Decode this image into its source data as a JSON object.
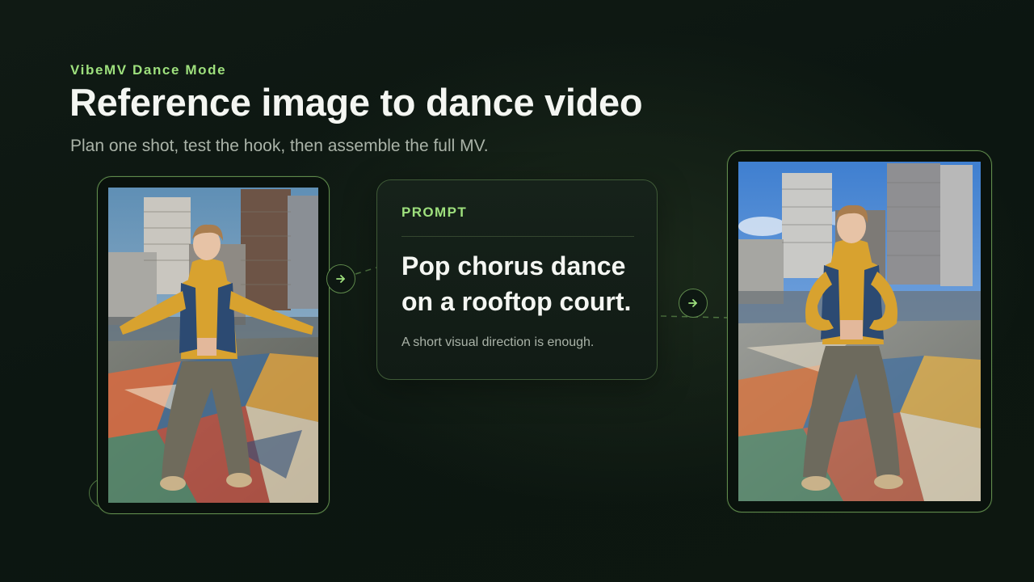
{
  "header": {
    "eyebrow": "VibeMV Dance Mode",
    "title": "Reference image to dance video",
    "subtitle": "Plan one shot, test the hook, then assemble the full MV."
  },
  "prompt_card": {
    "label": "PROMPT",
    "text": "Pop chorus dance on a rooftop court.",
    "hint": "A short visual direction is enough."
  },
  "images": {
    "reference": "reference-dancer-photo",
    "result": "generated-dance-video-frame"
  },
  "icons": {
    "connector": "arrow-right-icon"
  },
  "colors": {
    "accent": "#9ee07d",
    "frame_border": "#5f8a4c",
    "background": "#0c1611",
    "text_primary": "#f4f6f2",
    "text_muted": "#aab3a8"
  }
}
